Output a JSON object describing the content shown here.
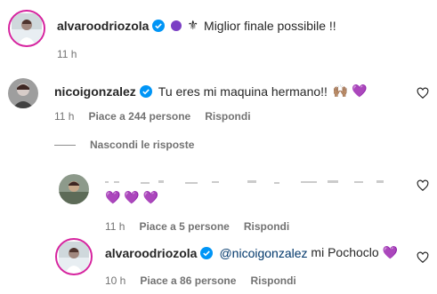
{
  "comments": [
    {
      "username": "alvaroodriozola",
      "verified": true,
      "text": "Miglior finale possibile !!",
      "emoji_prefix": "⚜",
      "time": "11 h"
    },
    {
      "username": "nicoigonzalez",
      "verified": true,
      "text": "Tu eres mi maquina hermano!!",
      "emojis": "🙌🏽 💜",
      "time": "11 h",
      "likes": "Piace a 244 persone",
      "reply": "Rispondi"
    }
  ],
  "toggle_replies": "Nascondi le risposte",
  "replies": [
    {
      "username": "",
      "text": "",
      "emojis": "💜 💜 💜",
      "time": "11 h",
      "likes": "Piace a 5 persone",
      "reply": "Rispondi"
    },
    {
      "username": "alvaroodriozola",
      "verified": true,
      "mention": "@nicoigonzalez",
      "text": " mi Pochoclo 💜",
      "time": "10 h",
      "likes": "Piace a 86 persone",
      "reply": "Rispondi"
    }
  ],
  "colors": {
    "verified_blue": "#0095f6",
    "purple": "#7b3fc4",
    "text": "#262626",
    "muted": "#737373",
    "mention": "#00376b"
  }
}
